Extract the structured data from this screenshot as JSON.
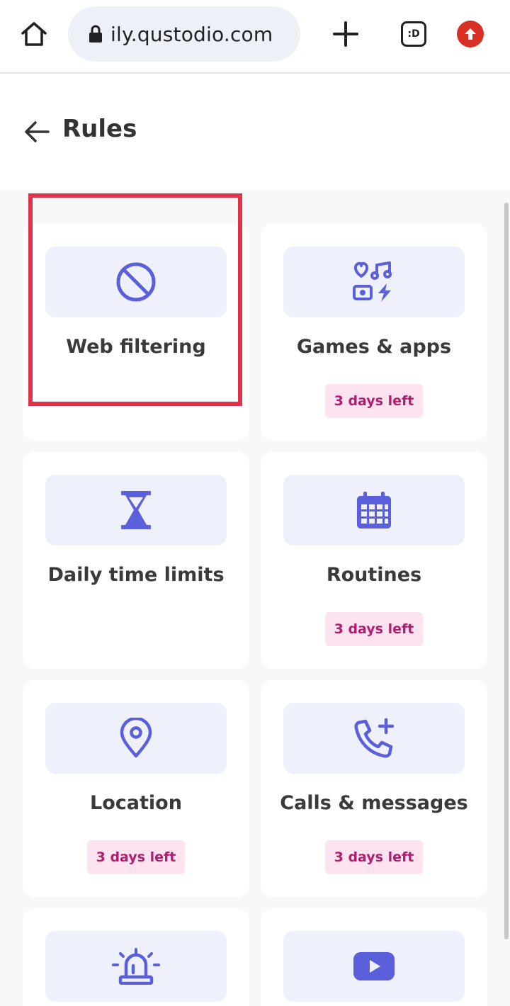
{
  "browser": {
    "url": "ily.qustodio.com",
    "tabs_label": ":D",
    "icons": [
      "home-icon",
      "lock-icon",
      "plus-icon",
      "tabs-icon",
      "update-icon"
    ]
  },
  "header": {
    "title": "Rules",
    "back_icon": "arrow-left-icon"
  },
  "colors": {
    "accent": "#5b5fdb",
    "icon_bg": "#eef0fc",
    "badge_bg": "#fde3ef",
    "badge_text": "#b31c6f",
    "highlight": "#e0324b"
  },
  "cards": [
    {
      "label": "Web filtering",
      "icon": "block-icon",
      "badge": ""
    },
    {
      "label": "Games & apps",
      "icon": "games-apps-icon",
      "badge": "3 days left"
    },
    {
      "label": "Daily time limits",
      "icon": "hourglass-icon",
      "badge": ""
    },
    {
      "label": "Routines",
      "icon": "calendar-icon",
      "badge": "3 days left"
    },
    {
      "label": "Location",
      "icon": "location-pin-icon",
      "badge": "3 days left"
    },
    {
      "label": "Calls & messages",
      "icon": "phone-plus-icon",
      "badge": "3 days left"
    },
    {
      "label": "",
      "icon": "siren-icon",
      "badge": ""
    },
    {
      "label": "",
      "icon": "youtube-icon",
      "badge": ""
    }
  ]
}
